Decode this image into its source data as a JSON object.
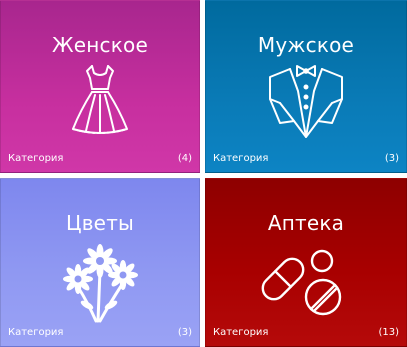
{
  "tiles": [
    {
      "title": "Женское",
      "category_label": "Категория",
      "count": "(4)",
      "icon": "dress-icon",
      "color": "#c72f9f"
    },
    {
      "title": "Мужское",
      "category_label": "Категория",
      "count": "(3)",
      "icon": "tuxedo-bowtie-icon",
      "color": "#0a7bb7"
    },
    {
      "title": "Цветы",
      "category_label": "Категория",
      "count": "(3)",
      "icon": "flowers-icon",
      "color": "#8f98f2"
    },
    {
      "title": "Аптека",
      "category_label": "Категория",
      "count": "(13)",
      "icon": "pills-icon",
      "color": "#a80000"
    }
  ]
}
